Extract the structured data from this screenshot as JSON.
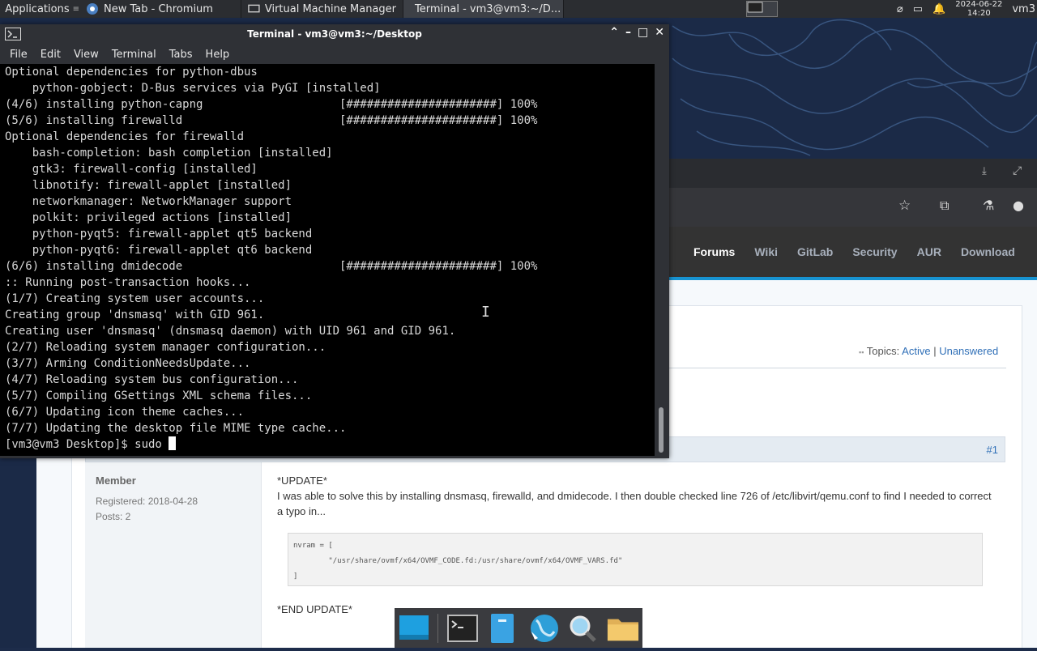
{
  "top_panel": {
    "apps_label": "Applications",
    "tasks": [
      {
        "label": "New Tab - Chromium"
      },
      {
        "label": "Virtual Machine Manager"
      },
      {
        "label": "Terminal - vm3@vm3:~/D..."
      }
    ],
    "clock_date": "2024-06-22",
    "clock_time": "14:20",
    "user": "vm3"
  },
  "terminal": {
    "title": "Terminal - vm3@vm3:~/Desktop",
    "menu": [
      "File",
      "Edit",
      "View",
      "Terminal",
      "Tabs",
      "Help"
    ],
    "lines": [
      "Optional dependencies for python-dbus",
      "    python-gobject: D-Bus services via PyGI [installed]",
      "(4/6) installing python-capng                    [######################] 100%",
      "(5/6) installing firewalld                       [######################] 100%",
      "Optional dependencies for firewalld",
      "    bash-completion: bash completion [installed]",
      "    gtk3: firewall-config [installed]",
      "    libnotify: firewall-applet [installed]",
      "    networkmanager: NetworkManager support",
      "    polkit: privileged actions [installed]",
      "    python-pyqt5: firewall-applet qt5 backend",
      "    python-pyqt6: firewall-applet qt6 backend",
      "(6/6) installing dmidecode                       [######################] 100%",
      ":: Running post-transaction hooks...",
      "(1/7) Creating system user accounts...",
      "Creating group 'dnsmasq' with GID 961.",
      "Creating user 'dnsmasq' (dnsmasq daemon) with UID 961 and GID 961.",
      "(2/7) Reloading system manager configuration...",
      "(3/7) Arming ConditionNeedsUpdate...",
      "(4/7) Reloading system bus configuration...",
      "(5/7) Compiling GSettings XML schema files...",
      "(6/7) Updating icon theme caches...",
      "(7/7) Updating the desktop file MIME type cache..."
    ],
    "prompt": "[vm3@vm3 Desktop]$ sudo "
  },
  "browser": {
    "nav": [
      "Forums",
      "Wiki",
      "GitLab",
      "Security",
      "AUR",
      "Download"
    ],
    "topics_label": "Topics:",
    "topics_active": "Active",
    "topics_sep": "|",
    "topics_unanswered": "Unanswered",
    "post_number": "#1",
    "user_role": "Member",
    "registered": "Registered: 2018-04-28",
    "posts": "Posts: 2",
    "update_heading": "*UPDATE*",
    "update_text": "I was able to solve this by installing dnsmasq, firewalld, and dmidecode. I then double checked line 726 of /etc/libvirt/qemu.conf to find I needed to correct a typo in...",
    "code_lines": [
      "nvram = [",
      "        \"/usr/share/ovmf/x64/OVMF_CODE.fd:/usr/share/ovmf/x64/OVMF_VARS.fd\"",
      "]"
    ],
    "end_update": "*END UPDATE*"
  }
}
